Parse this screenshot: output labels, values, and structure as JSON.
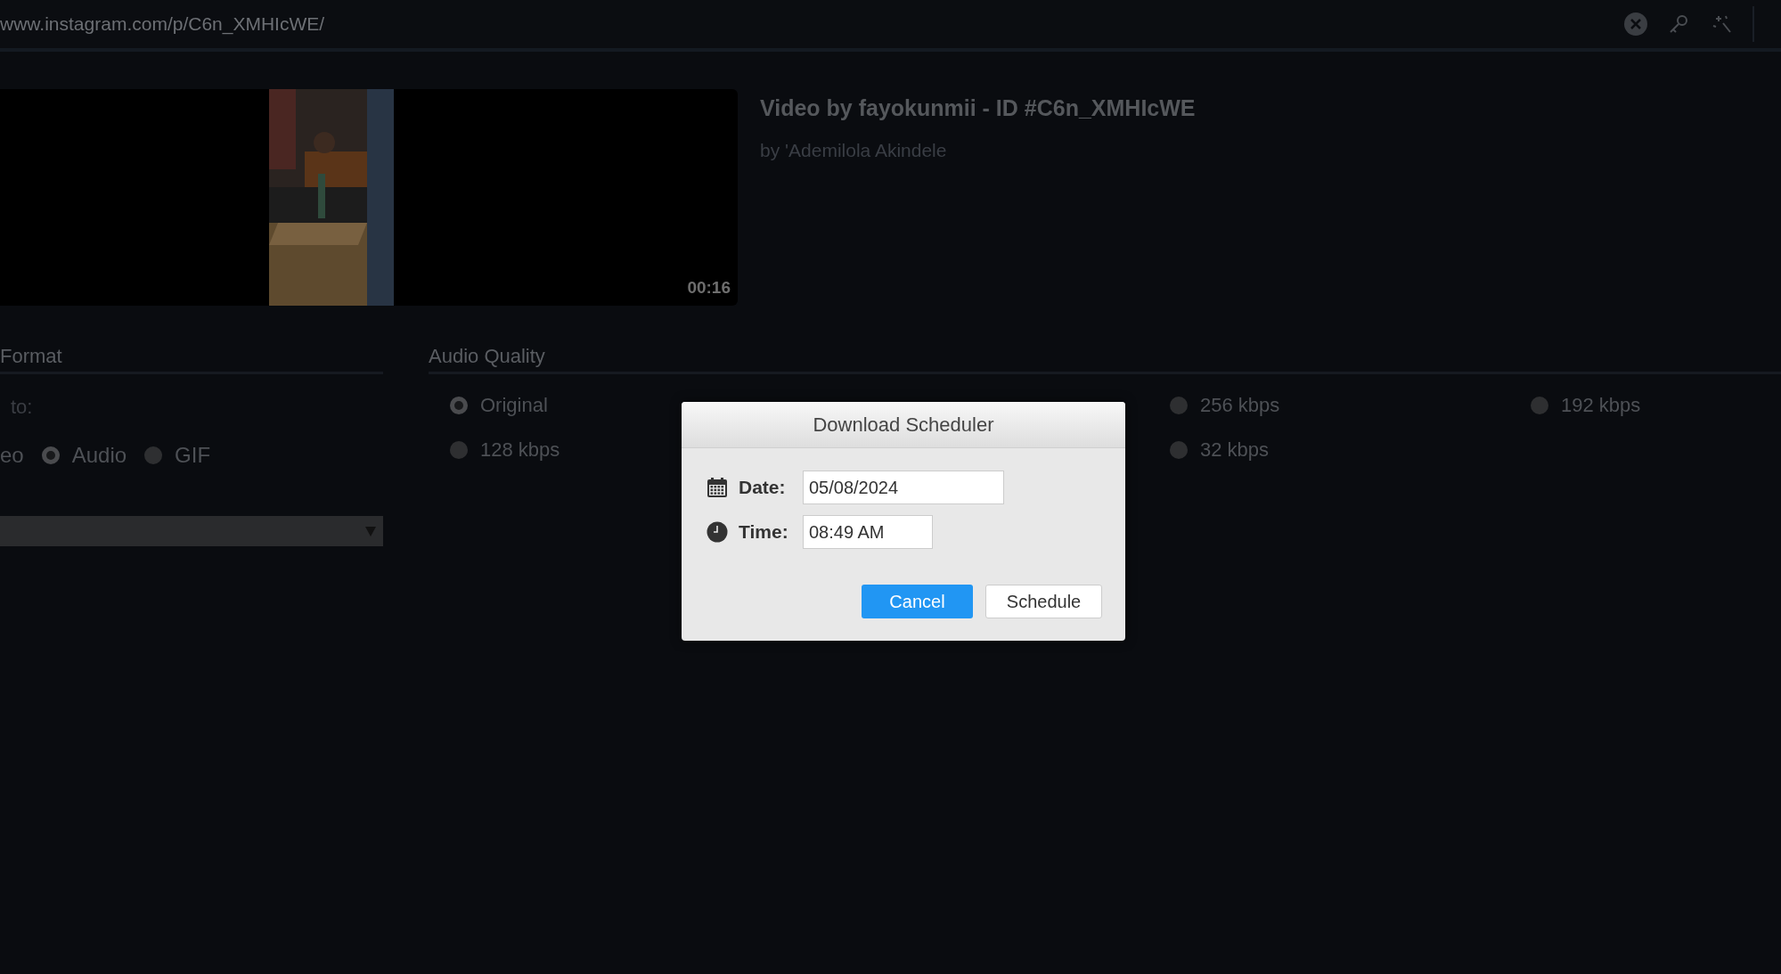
{
  "address_bar": {
    "url": "www.instagram.com/p/C6n_XMHIcWE/"
  },
  "video": {
    "kind": "picture",
    "duration": "00:16",
    "title": "Video by fayokunmii - ID #C6n_XMHIcWE",
    "author": "by 'Ademilola Akindele"
  },
  "format_panel": {
    "heading": "Format",
    "label": "to:",
    "cut_option": "eo",
    "options": [
      {
        "label": "Audio",
        "selected": true
      },
      {
        "label": "GIF",
        "selected": false
      }
    ]
  },
  "audio_quality": {
    "heading": "Audio Quality",
    "columns": [
      [
        {
          "label": "Original",
          "selected": true
        },
        {
          "label": "128 kbps",
          "selected": false
        }
      ],
      [
        {
          "label": "256 kbps",
          "selected": false
        },
        {
          "label": "32 kbps",
          "selected": false
        }
      ],
      [
        {
          "label": "192 kbps",
          "selected": false
        }
      ]
    ]
  },
  "dialog": {
    "title": "Download Scheduler",
    "date_label": "Date:",
    "date_value": "05/08/2024",
    "time_label": "Time:",
    "time_value": "08:49 AM",
    "buttons": [
      {
        "label": "Cancel",
        "primary": true
      },
      {
        "label": "Schedule",
        "primary": false
      }
    ]
  }
}
